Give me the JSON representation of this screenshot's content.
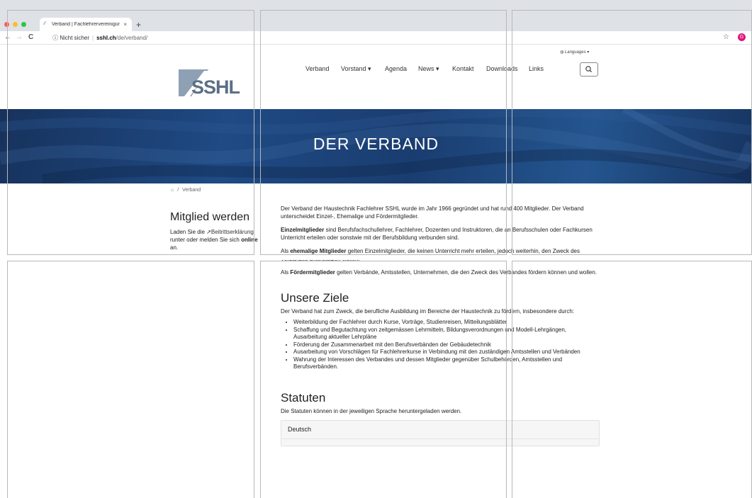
{
  "browser": {
    "tab_title": "Verband | Fachlehrervereinigung",
    "tab_close": "×",
    "new_tab": "+",
    "back": "←",
    "forward": "→",
    "reload": "C",
    "security": "ⓘ Nicht sicher",
    "url_host": "sshl.ch",
    "url_path": "/de/verband/",
    "profile_letter": "G",
    "colors": {
      "close": "#ff5f57",
      "minimize": "#febc2e",
      "zoom": "#28c840"
    }
  },
  "header": {
    "languages": "◍ Languages ▾",
    "logo_text": "SSHL",
    "nav": [
      {
        "label": "Verband"
      },
      {
        "label": "Vorstand ▾"
      },
      {
        "label": "Agenda"
      },
      {
        "label": "News ▾"
      },
      {
        "label": "Kontakt"
      },
      {
        "label": "Downloads"
      },
      {
        "label": "Links"
      }
    ]
  },
  "hero": {
    "title": "DER VERBAND"
  },
  "breadcrumb": {
    "home_icon": "⌂",
    "sep": "/",
    "current": "Verband"
  },
  "sidebar": {
    "title": "Mitglied werden",
    "text_1": "Laden Sie die ",
    "link_icon": "↗",
    "link": "Beitrittserklärung",
    "text_2": " runter oder melden Sie sich ",
    "bold": "online",
    "text_3": " an."
  },
  "main": {
    "intro": "Der Verband der Haustechnik Fachlehrer SSHL wurde im Jahr 1966 gegründet und hat rund 400 Mitglieder. Der Verband unterscheidet Einzel-, Ehemalige und Fördermitglieder.",
    "p1_bold": "Einzelmitglieder",
    "p1_rest": " sind Berufsfachschullehrer, Fachlehrer, Dozenten und Instruktoren, die an Berufsschulen oder Fachkursen Unterricht erteilen oder sonstwie mit der Berufsbildung verbunden sind.",
    "p2_a": "Als ",
    "p2_bold": "ehemalige Mitglieder",
    "p2_rest": " gelten Einzelmitglieder, die keinen Unterricht mehr erteilen, jedoch weiterhin, den Zweck des Verbandes unterstützen wollen.",
    "p3_a": "Als ",
    "p3_bold": "Fördermitglieder",
    "p3_rest": " gelten Verbände, Amtsstellen, Unternehmen, die den Zweck des Verbandes fördern können und wollen.",
    "goals_title": "Unsere Ziele",
    "goals_intro": "Der Verband hat zum Zweck, die berufliche  Ausbildung im Bereiche der Haustechnik zu fördern, insbesondere durch:",
    "goals": [
      "Weiterbildung der Fachlehrer durch Kurse, Vorträge, Studienreisen, Mitteilungsblätter",
      "Schaffung und Begutachtung von zeitgemässen Lehrmitteln, Bildungsverordnungen und Modell-Lehrgängen, Ausarbeitung aktueller Lehrpläne",
      "Förderung der Zusammenarbeit mit den Berufsverbänden der Gebäudetechnik",
      "Ausarbeitung von Vorschlägen für Fachlehrerkurse in Verbindung mit den zuständigen Amtsstellen und Verbänden",
      "Wahrung der Interessen des Verbandes und dessen Mitglieder gegenüber Schulbehörden, Amtsstellen und Berufsverbänden."
    ],
    "statuten_title": "Statuten",
    "statuten_text": "Die Statuten können in der jeweiligen Sprache heruntergeladen werden.",
    "accordion": [
      "Deutsch"
    ]
  },
  "search_icon_name": "search-icon"
}
